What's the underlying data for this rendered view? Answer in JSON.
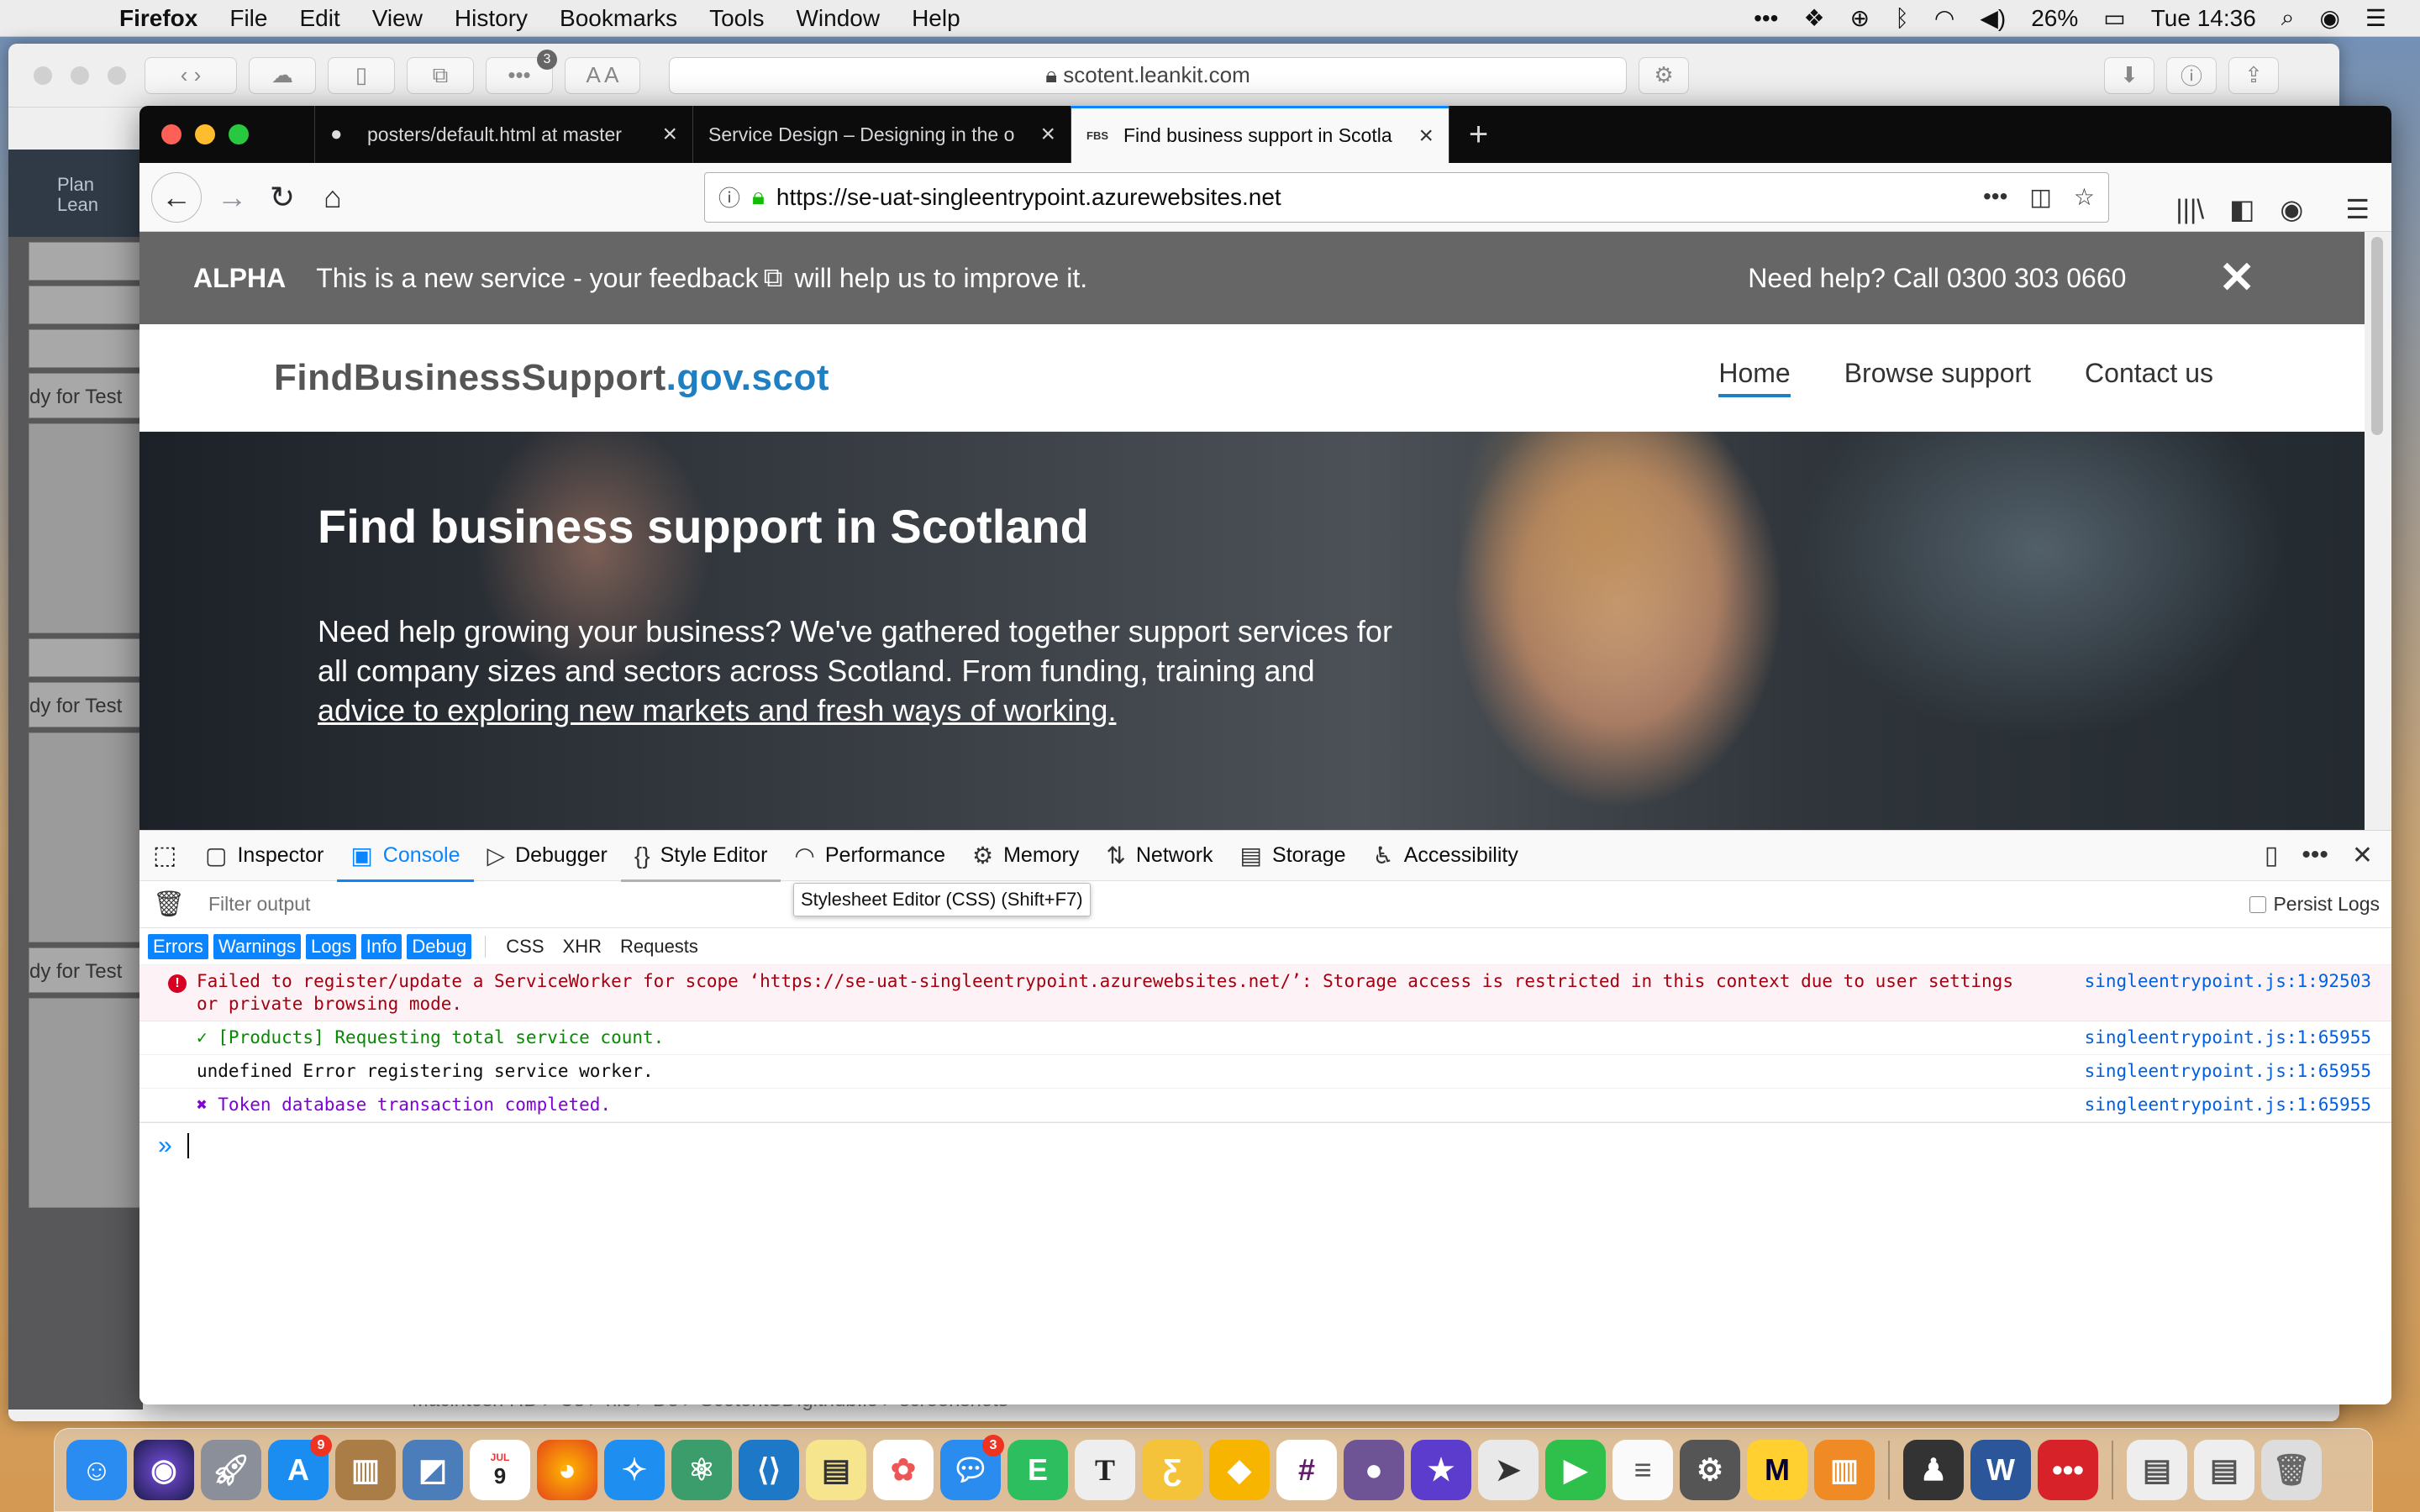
{
  "menubar": {
    "app": "Firefox",
    "items": [
      "File",
      "Edit",
      "View",
      "History",
      "Bookmarks",
      "Tools",
      "Window",
      "Help"
    ],
    "battery": "26%",
    "clock": "Tue 14:36"
  },
  "bg_window": {
    "url": "scotent.leankit.com",
    "notif_count": "3",
    "logo_text": "Plan\nLean",
    "lane_label": "dy for Test",
    "status_bar": "Macintosh HD ▸ Us ▸ nic ▸ De ▸ ScotentSD.github.io ▸ screenshots"
  },
  "tabs": [
    {
      "label": "posters/default.html at master",
      "icon": "github-icon"
    },
    {
      "label": "Service Design – Designing in the o",
      "icon": "none"
    },
    {
      "label": "Find business support in Scotla",
      "icon": "fbs-favicon",
      "favicon_text": "FBS"
    }
  ],
  "navbar": {
    "url": "https://se-uat-singleentrypoint.azurewebsites.net"
  },
  "page": {
    "alpha_tag": "ALPHA",
    "alpha_text": "This is a new service - your feedback",
    "alpha_text_after": "will help us to improve it.",
    "help": "Need help? Call 0300 303 0660",
    "brand_main": "FindBusinessSupport",
    "brand_gov": ".gov.scot",
    "nav": [
      "Home",
      "Browse support",
      "Contact us"
    ],
    "hero_title": "Find business support in Scotland",
    "hero_text": "Need help growing your business? We've gathered together support services for all company sizes and sectors across Scotland. From funding, training and",
    "hero_text_link": "advice to exploring new markets and fresh ways of working."
  },
  "devtools": {
    "tabs": [
      "Inspector",
      "Console",
      "Debugger",
      "Style Editor",
      "Performance",
      "Memory",
      "Network",
      "Storage",
      "Accessibility"
    ],
    "active_tab": "Console",
    "tooltip": "Stylesheet Editor (CSS) (Shift+F7)",
    "filter_placeholder": "Filter output",
    "persist_logs": "Persist Logs",
    "levels": [
      "Errors",
      "Warnings",
      "Logs",
      "Info",
      "Debug"
    ],
    "types": [
      "CSS",
      "XHR",
      "Requests"
    ],
    "messages": [
      {
        "kind": "error",
        "text": "Failed to register/update a ServiceWorker for scope ‘https://se-uat-singleentrypoint.azurewebsites.net/’: Storage access is restricted in this context due to user settings or private browsing mode.",
        "source": "singleentrypoint.js:1:92503"
      },
      {
        "kind": "ok",
        "text": "✓ [Products] Requesting total service count.",
        "source": "singleentrypoint.js:1:65955"
      },
      {
        "kind": "plain",
        "text": "undefined Error registering service worker.",
        "source": "singleentrypoint.js:1:65955"
      },
      {
        "kind": "purple",
        "text": "✖ Token database transaction completed.",
        "source": "singleentrypoint.js:1:65955"
      }
    ]
  },
  "dock": {
    "calendar_day": "9",
    "calendar_month": "JUL",
    "badges": {
      "appstore": "9",
      "messages": "3"
    }
  }
}
